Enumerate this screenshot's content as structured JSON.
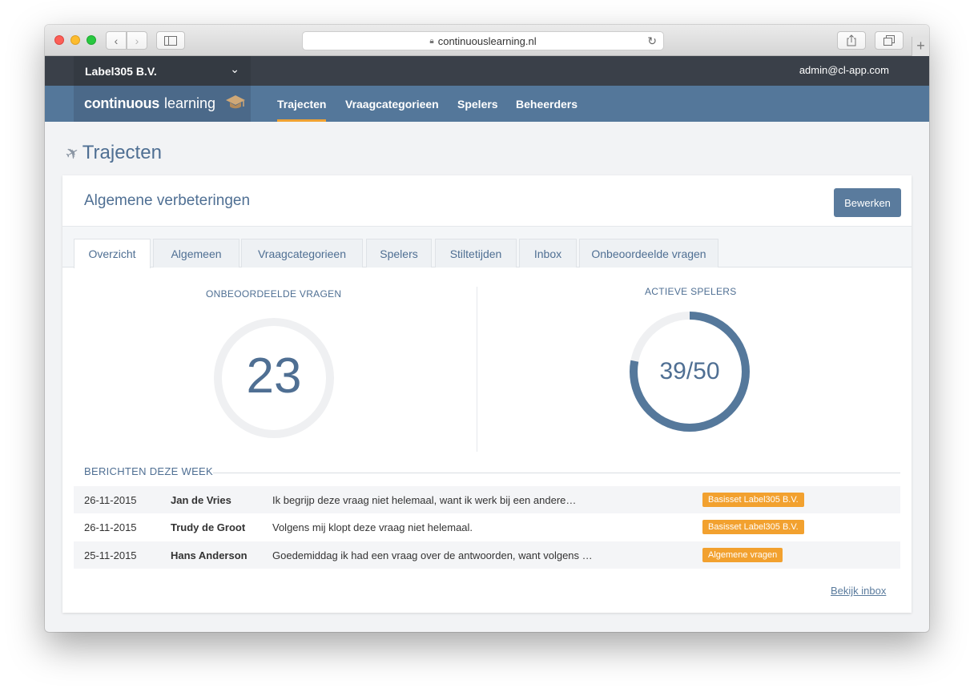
{
  "browser": {
    "url": "continuouslearning.nl"
  },
  "topbar": {
    "organization": "Label305 B.V.",
    "user_email": "admin@cl-app.com"
  },
  "navbar": {
    "brand_bold": "continuous",
    "brand_light": "learning",
    "items": [
      "Trajecten",
      "Vraagcategorieen",
      "Spelers",
      "Beheerders"
    ],
    "active": "Trajecten"
  },
  "page": {
    "title": "Trajecten"
  },
  "card": {
    "title": "Algemene verbeteringen",
    "edit_label": "Bewerken",
    "tabs": [
      "Overzicht",
      "Algemeen",
      "Vraagcategorieen",
      "Spelers",
      "Stiltetijden",
      "Inbox",
      "Onbeoordeelde vragen"
    ],
    "active_tab": "Overzicht"
  },
  "stats": {
    "unrated_label": "ONBEOORDEELDE VRAGEN",
    "unrated_value": "23",
    "active_label": "ACTIEVE SPELERS",
    "active_value": "39/50",
    "active_fraction": 0.78
  },
  "messages": {
    "title": "BERICHTEN DEZE WEEK",
    "rows": [
      {
        "date": "26-11-2015",
        "name": "Jan de Vries",
        "message": "Ik begrijp deze vraag niet helemaal, want ik werk bij een andere…",
        "badge": "Basisset Label305 B.V."
      },
      {
        "date": "26-11-2015",
        "name": "Trudy de Groot",
        "message": "Volgens mij klopt deze vraag niet helemaal.",
        "badge": "Basisset Label305 B.V."
      },
      {
        "date": "25-11-2015",
        "name": "Hans Anderson",
        "message": "Goedemiddag ik had een vraag over de antwoorden, want volgens m…",
        "badge": "Algemene vragen"
      }
    ],
    "inbox_link": "Bekijk inbox"
  },
  "colors": {
    "accent": "#f2a12f",
    "primary": "#54779a",
    "ring_track": "#eff0f2"
  }
}
